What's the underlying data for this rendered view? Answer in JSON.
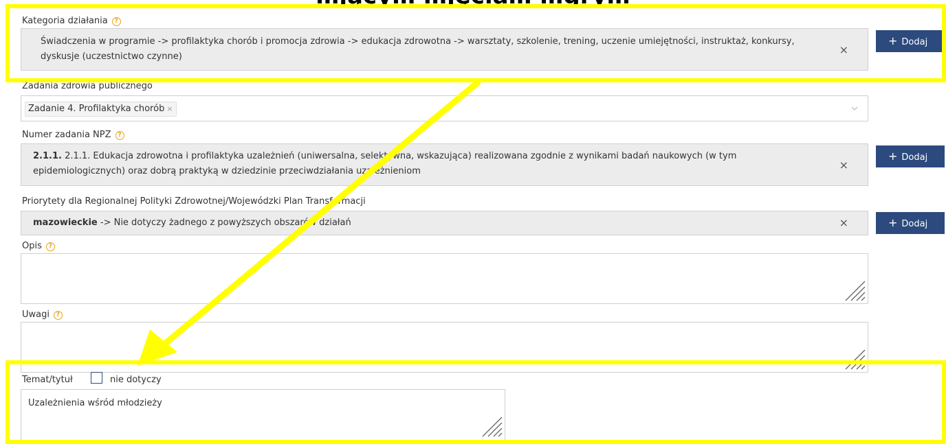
{
  "headline": "…jący…                 …jęcia…  …gry…",
  "kategoria": {
    "label": "Kategoria działania",
    "value": "Świadczenia w programie -> profilaktyka chorób i promocja zdrowia -> edukacja zdrowotna -> warsztaty, szkolenie, trening, uczenie umiejętności, instruktaż, konkursy, dyskusje (uczestnictwo czynne)",
    "clear": "×",
    "add": "Dodaj"
  },
  "zadania": {
    "label": "Zadania zdrowia publicznego",
    "tag": "Zadanie 4. Profilaktyka chorób",
    "tag_remove": "×",
    "chevron": "chevron-down-icon"
  },
  "npz": {
    "label": "Numer zadania NPZ",
    "code": "2.1.1.",
    "value": "2.1.1. Edukacja zdrowotna i profilaktyka uzależnień (uniwersalna, selektywna, wskazująca) realizowana zgodnie z wynikami badań naukowych (w tym epidemiologicznych) oraz dobrą praktyką w dziedzinie przeciwdziałania uzależnieniom",
    "clear": "×",
    "add": "Dodaj"
  },
  "priorytety": {
    "label": "Priorytety dla Regionalnej Polityki Zdrowotnej/Wojewódzki Plan Transformacji",
    "code": "mazowieckie",
    "value": "mazowieckie -> Nie dotyczy żadnego z powyższych obszarów działań",
    "clear": "×",
    "add": "Dodaj"
  },
  "opis": {
    "label": "Opis"
  },
  "uwagi": {
    "label": "Uwagi"
  },
  "temat": {
    "label": "Temat/tytuł",
    "checkbox_label": "nie dotyczy",
    "checked": false,
    "value": "Uzależnienia wśród młodzieży"
  },
  "colors": {
    "accent": "#2c4a7d",
    "highlight": "#ffff00",
    "help": "#e8a317",
    "field_bg": "#ececec"
  }
}
